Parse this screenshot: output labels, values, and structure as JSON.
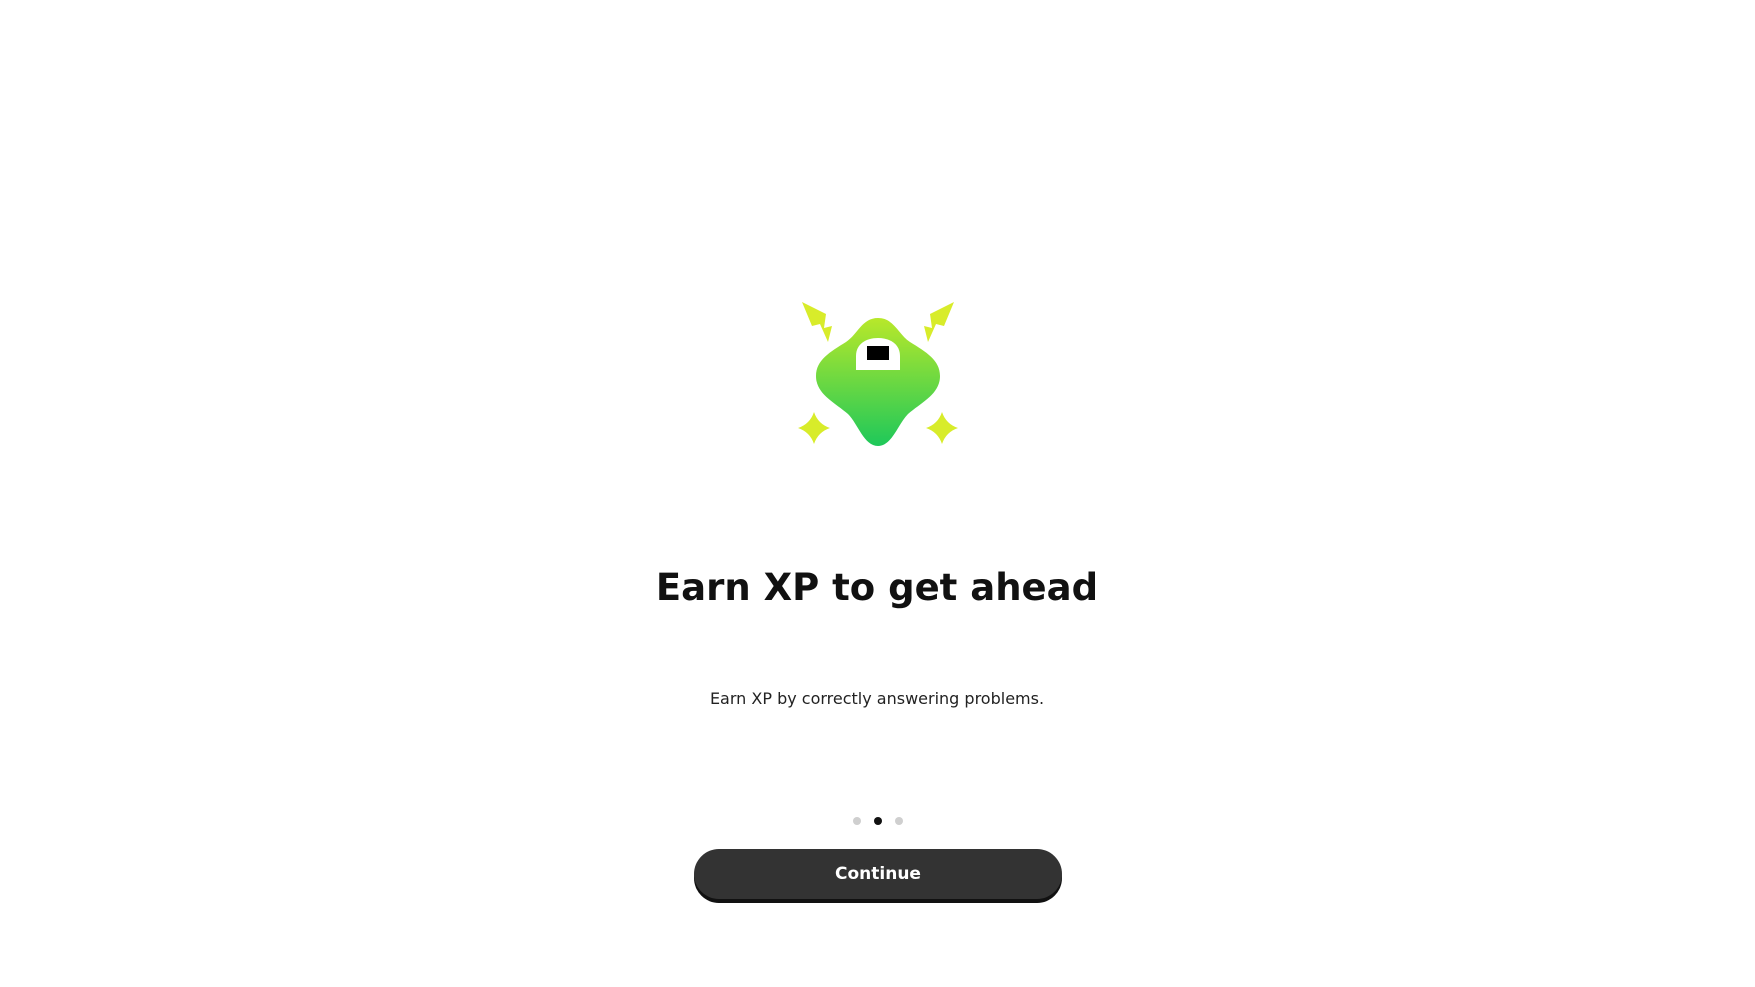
{
  "onboarding": {
    "mascot_icon": "green-xp-mascot-icon",
    "title": "Earn XP to get ahead",
    "subtitle": "Earn XP by correctly answering problems.",
    "pagination": {
      "total": 3,
      "active_index": 1
    },
    "continue_label": "Continue"
  },
  "colors": {
    "mascot_green_top": "#b8e82a",
    "mascot_green_bottom": "#1ec85a",
    "accent_yellow": "#d8ec2a",
    "button_bg": "#333333",
    "dot_active": "#111111",
    "dot_inactive": "#cfcfcf"
  }
}
